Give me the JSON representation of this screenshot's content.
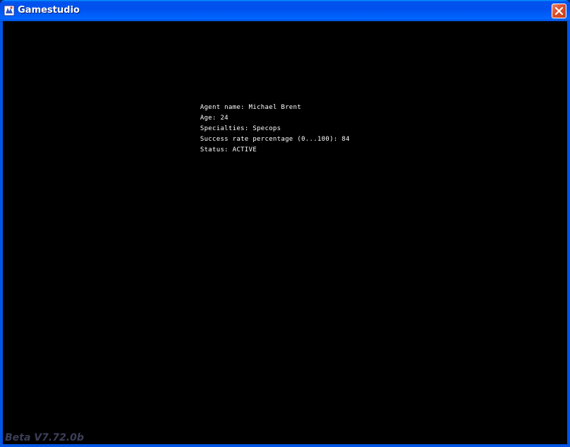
{
  "window": {
    "title": "Gamestudio",
    "app_icon": "gamestudio-app-icon",
    "close_icon": "close-icon"
  },
  "agent_info": {
    "lines": [
      "Agent name: Michael Brent",
      "Age: 24",
      "Specialties: Specops",
      "Success rate percentage (0...100): 84",
      "Status: ACTIVE"
    ]
  },
  "footer": {
    "version": "Beta V7.72.0b"
  },
  "colors": {
    "titlebar": "#0053ee",
    "close_button": "#e0512f",
    "client_background": "#000000",
    "text": "#ffffff",
    "version_text": "#3c3f58"
  }
}
